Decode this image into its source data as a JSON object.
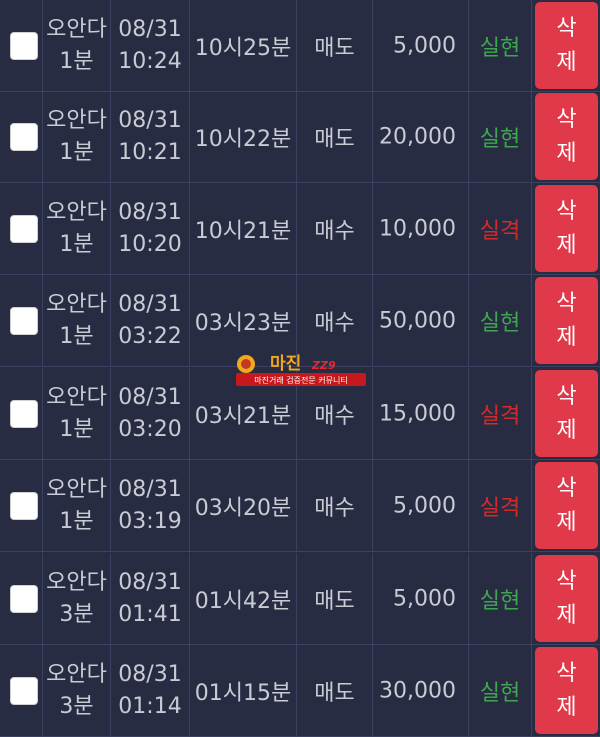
{
  "rows": [
    {
      "game_line1": "오안다",
      "game_line2": "1분",
      "date": "08/31",
      "time": "10:24",
      "round": "10시25분",
      "type": "매도",
      "amount": "5,000",
      "result": "실현",
      "result_status": "win",
      "delete_line1": "삭",
      "delete_line2": "제"
    },
    {
      "game_line1": "오안다",
      "game_line2": "1분",
      "date": "08/31",
      "time": "10:21",
      "round": "10시22분",
      "type": "매도",
      "amount": "20,000",
      "result": "실현",
      "result_status": "win",
      "delete_line1": "삭",
      "delete_line2": "제"
    },
    {
      "game_line1": "오안다",
      "game_line2": "1분",
      "date": "08/31",
      "time": "10:20",
      "round": "10시21분",
      "type": "매수",
      "amount": "10,000",
      "result": "실격",
      "result_status": "lose",
      "delete_line1": "삭",
      "delete_line2": "제"
    },
    {
      "game_line1": "오안다",
      "game_line2": "1분",
      "date": "08/31",
      "time": "03:22",
      "round": "03시23분",
      "type": "매수",
      "amount": "50,000",
      "result": "실현",
      "result_status": "win",
      "delete_line1": "삭",
      "delete_line2": "제"
    },
    {
      "game_line1": "오안다",
      "game_line2": "1분",
      "date": "08/31",
      "time": "03:20",
      "round": "03시21분",
      "type": "매수",
      "amount": "15,000",
      "result": "실격",
      "result_status": "lose",
      "delete_line1": "삭",
      "delete_line2": "제"
    },
    {
      "game_line1": "오안다",
      "game_line2": "1분",
      "date": "08/31",
      "time": "03:19",
      "round": "03시20분",
      "type": "매수",
      "amount": "5,000",
      "result": "실격",
      "result_status": "lose",
      "delete_line1": "삭",
      "delete_line2": "제"
    },
    {
      "game_line1": "오안다",
      "game_line2": "3분",
      "date": "08/31",
      "time": "01:41",
      "round": "01시42분",
      "type": "매도",
      "amount": "5,000",
      "result": "실현",
      "result_status": "win",
      "delete_line1": "삭",
      "delete_line2": "제"
    },
    {
      "game_line1": "오안다",
      "game_line2": "3분",
      "date": "08/31",
      "time": "01:14",
      "round": "01시15분",
      "type": "매도",
      "amount": "30,000",
      "result": "실현",
      "result_status": "win",
      "delete_line1": "삭",
      "delete_line2": "제"
    }
  ],
  "watermark": {
    "title": "마진",
    "badge": "ZZ9",
    "subtitle": "마진거래 검증전문 커뮤니티"
  },
  "colors": {
    "background": "#272c43",
    "win": "#3ea64c",
    "lose": "#d32a2a",
    "delete": "#e0394a"
  }
}
